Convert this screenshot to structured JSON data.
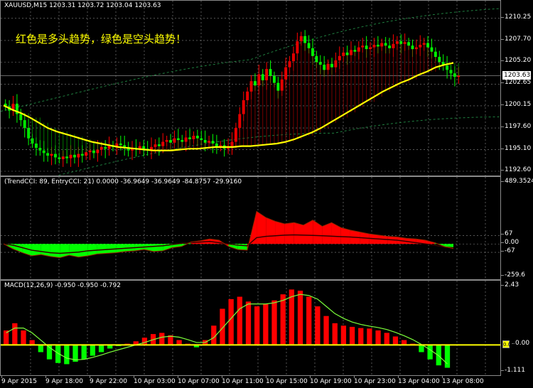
{
  "main_pane": {
    "title": "XAUUSD,M15  1203.31 1203.72 1203.04 1203.63",
    "annotation": "红色是多头趋势，绿色是空头趋势！",
    "current_price": "1203.63",
    "price_ticks": [
      "1210.25",
      "1207.70",
      "1205.20",
      "1202.65",
      "1200.15",
      "1197.60",
      "1195.10",
      "1192.60"
    ]
  },
  "cci_pane": {
    "title": "(TrendCCI: 89, EntryCCI: 21)  0.0000 -36.9649 -36.9649 -84.8757 -29.9160",
    "ticks": [
      "489.3524",
      "67",
      "0.00",
      "-67",
      "-259.6"
    ]
  },
  "macd_pane": {
    "title": "MACD(12,26,9) -0.950 -0.950 -0.792",
    "ticks": [
      "2.43",
      "0.00",
      "-1.111"
    ]
  },
  "time_axis": [
    "9 Apr 2015",
    "9 Apr 18:00",
    "9 Apr 22:00",
    "10 Apr 03:00",
    "10 Apr 07:00",
    "10 Apr 11:00",
    "10 Apr 15:00",
    "10 Apr 19:00",
    "10 Apr 23:00",
    "13 Apr 04:00",
    "13 Apr 08:00"
  ],
  "colors": {
    "background": "#000000",
    "bull": "#ff0000",
    "bear": "#00ff00",
    "ma": "#ffff00",
    "signal": "#7cff3a",
    "grid": "#8a8a8a",
    "annotation": "#ffff00"
  },
  "chart_data": [
    {
      "type": "candlestick",
      "symbol": "XAUUSD",
      "timeframe": "M15",
      "ylim": [
        1192.6,
        1211.3
      ],
      "ohlc_last": {
        "open": 1203.31,
        "high": 1203.72,
        "low": 1203.04,
        "close": 1203.63
      },
      "close_series": [
        1200.1,
        1199.6,
        1200.4,
        1199.2,
        1198.5,
        1197.6,
        1196.4,
        1195.8,
        1195.3,
        1195.0,
        1194.7,
        1194.4,
        1194.6,
        1194.2,
        1194.0,
        1194.3,
        1194.1,
        1194.5,
        1194.2,
        1194.6,
        1194.4,
        1194.8,
        1195.0,
        1194.7,
        1195.1,
        1195.4,
        1195.2,
        1195.6,
        1195.4,
        1195.8,
        1195.6,
        1195.4,
        1195.0,
        1195.3,
        1195.1,
        1195.5,
        1195.2,
        1195.0,
        1195.4,
        1195.7,
        1195.5,
        1196.0,
        1196.2,
        1195.9,
        1196.4,
        1196.2,
        1196.0,
        1196.5,
        1196.3,
        1196.7,
        1196.4,
        1196.2,
        1195.9,
        1196.1,
        1195.8,
        1195.4,
        1195.6,
        1195.2,
        1195.5,
        1196.0,
        1197.6,
        1199.2,
        1200.8,
        1201.8,
        1203.0,
        1202.5,
        1203.8,
        1203.1,
        1204.4,
        1203.6,
        1202.8,
        1201.9,
        1203.2,
        1204.6,
        1205.3,
        1206.2,
        1207.6,
        1208.2,
        1207.4,
        1206.8,
        1205.9,
        1205.2,
        1204.9,
        1204.3,
        1205.0,
        1204.6,
        1205.4,
        1205.9,
        1206.3,
        1206.0,
        1206.6,
        1206.4,
        1206.9,
        1207.1,
        1206.7,
        1206.9,
        1207.2,
        1207.0,
        1207.4,
        1207.1,
        1206.8,
        1207.3,
        1207.6,
        1207.3,
        1207.5,
        1207.1,
        1206.7,
        1206.9,
        1207.2,
        1207.4,
        1206.9,
        1206.4,
        1205.8,
        1205.2,
        1204.8,
        1204.3,
        1203.9,
        1203.5,
        1203.63
      ],
      "ma_series": [
        1200.2,
        1199.7,
        1199.3,
        1198.8,
        1198.2,
        1197.6,
        1197.2,
        1196.9,
        1196.6,
        1196.3,
        1196.0,
        1195.8,
        1195.6,
        1195.4,
        1195.3,
        1195.2,
        1195.1,
        1195.0,
        1195.0,
        1195.0,
        1195.1,
        1195.2,
        1195.2,
        1195.3,
        1195.4,
        1195.4,
        1195.4,
        1195.5,
        1195.5,
        1195.6,
        1195.7,
        1195.8,
        1196.0,
        1196.3,
        1196.7,
        1197.1,
        1197.6,
        1198.2,
        1198.8,
        1199.4,
        1200.0,
        1200.6,
        1201.2,
        1201.8,
        1202.3,
        1202.8,
        1203.2,
        1203.7,
        1204.1,
        1204.6,
        1204.9,
        1205.1
      ],
      "bands": {
        "upper_start": 1206.0,
        "lower_start": 1198.8
      }
    },
    {
      "type": "area",
      "name": "TrendCCI",
      "ylim": [
        -259.6,
        489.3524
      ],
      "levels": [
        67,
        0,
        -67
      ],
      "values": [
        0,
        -40,
        -70,
        -95,
        -85,
        -100,
        -110,
        -90,
        -105,
        -95,
        -80,
        -75,
        -70,
        -60,
        -55,
        -45,
        -60,
        -55,
        -30,
        -20,
        15,
        25,
        40,
        30,
        -20,
        -45,
        -50,
        260,
        210,
        180,
        160,
        170,
        150,
        190,
        140,
        170,
        130,
        110,
        95,
        80,
        70,
        60,
        55,
        45,
        40,
        30,
        10,
        -20,
        -37
      ],
      "entry_values": [
        0,
        -10,
        -30,
        -50,
        -60,
        -70,
        -75,
        -70,
        -65,
        -55,
        -50,
        -45,
        -40,
        -35,
        -30,
        -25,
        -20,
        -15,
        -5,
        5,
        10,
        15,
        20,
        10,
        0,
        -10,
        -15,
        50,
        60,
        65,
        70,
        72,
        70,
        68,
        65,
        62,
        58,
        55,
        50,
        45,
        40,
        35,
        30,
        20,
        10,
        0,
        -10,
        -25,
        -30
      ]
    },
    {
      "type": "bar",
      "name": "MACD(12,26,9)",
      "ylim": [
        -1.111,
        2.43
      ],
      "values": [
        0.6,
        0.9,
        0.6,
        0.2,
        -0.3,
        -0.6,
        -0.75,
        -0.8,
        -0.7,
        -0.6,
        -0.45,
        -0.3,
        -0.15,
        -0.05,
        0.05,
        0.15,
        0.3,
        0.45,
        0.5,
        0.4,
        0.2,
        0.05,
        -0.1,
        0.2,
        0.8,
        1.5,
        1.9,
        2.0,
        1.8,
        1.6,
        1.7,
        1.85,
        2.1,
        2.3,
        2.25,
        2.0,
        1.6,
        1.2,
        0.9,
        0.8,
        0.75,
        0.7,
        0.68,
        0.6,
        0.5,
        0.35,
        0.2,
        0.05,
        -0.3,
        -0.6,
        -0.85,
        -0.95
      ],
      "signal_values": [
        0.5,
        0.7,
        0.7,
        0.5,
        0.2,
        -0.1,
        -0.35,
        -0.55,
        -0.62,
        -0.6,
        -0.52,
        -0.42,
        -0.3,
        -0.2,
        -0.1,
        0.0,
        0.1,
        0.22,
        0.32,
        0.36,
        0.32,
        0.22,
        0.1,
        0.1,
        0.3,
        0.7,
        1.1,
        1.5,
        1.7,
        1.7,
        1.7,
        1.75,
        1.85,
        2.0,
        2.1,
        2.05,
        1.9,
        1.6,
        1.3,
        1.1,
        0.95,
        0.85,
        0.78,
        0.72,
        0.64,
        0.52,
        0.38,
        0.22,
        0.02,
        -0.2,
        -0.45,
        -0.79
      ]
    }
  ]
}
